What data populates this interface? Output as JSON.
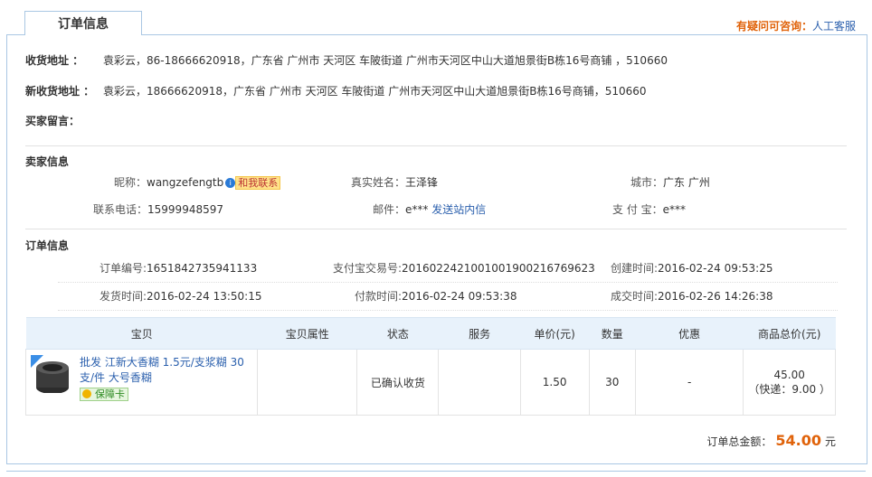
{
  "tab_title": "订单信息",
  "help": {
    "question": "有疑问可咨询：",
    "link": "人工客服"
  },
  "addresses": {
    "shipping_label": "收货地址 ：",
    "shipping_value": "袁彩云，86-18666620918，广东省 广州市 天河区 车陂街道 广州市天河区中山大道旭景街B栋16号商铺 ，510660",
    "new_label": "新收货地址 ：",
    "new_value": "袁彩云，18666620918，广东省 广州市 天河区 车陂街道 广州市天河区中山大道旭景街B栋16号商铺，510660",
    "message_label": "买家留言："
  },
  "seller": {
    "title": "卖家信息",
    "nick_label": "昵称：",
    "nick": "wangzefengtb",
    "contact": "和我联系",
    "realname_label": "真实姓名：",
    "realname": "王泽锋",
    "city_label": "城市：",
    "city": "广东 广州",
    "phone_label": "联系电话：",
    "phone": "15999948597",
    "email_label": "邮件：",
    "email": "e***",
    "sitemsg": "发送站内信",
    "alipay_label": "支 付 宝：",
    "alipay": "e***"
  },
  "order": {
    "title": "订单信息",
    "no_label": "订单编号:",
    "no": "1651842735941133",
    "alipay_no_label": "支付宝交易号:",
    "alipay_no": "2016022421001001900216769623",
    "created_label": "创建时间:",
    "created": "2016-02-24 09:53:25",
    "shipped_label": "发货时间:",
    "shipped": "2016-02-24 13:50:15",
    "paid_label": "付款时间:",
    "paid": "2016-02-24 09:53:38",
    "done_label": "成交时间:",
    "done": "2016-02-26 14:26:38"
  },
  "table": {
    "headers": [
      "宝贝",
      "宝贝属性",
      "状态",
      "服务",
      "单价(元)",
      "数量",
      "优惠",
      "商品总价(元)"
    ],
    "item": {
      "name": "批发 江新大香糊 1.5元/支浆糊 30支/件 大号香糊",
      "guarantee": "保障卡",
      "attr": "",
      "status": "已确认收货",
      "service": "",
      "price": "1.50",
      "qty": "30",
      "discount": "-",
      "total": "45.00",
      "shipping": "（快递：9.00 ）"
    }
  },
  "summary": {
    "label": "订单总金额：",
    "amount": "54.00",
    "unit": "元"
  }
}
